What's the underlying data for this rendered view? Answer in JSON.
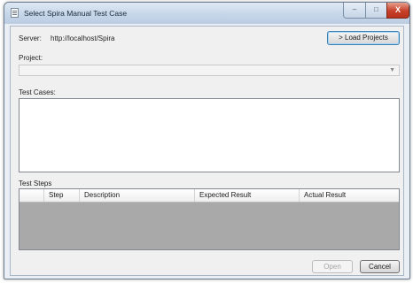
{
  "window": {
    "title": "Select Spira Manual Test Case",
    "controls": {
      "minimize": "–",
      "maximize": "□",
      "close": "X"
    }
  },
  "server": {
    "label": "Server:",
    "value": "http://localhost/Spira"
  },
  "load_projects_label": "> Load Projects",
  "project": {
    "label": "Project:",
    "selected": "",
    "dropdown_icon": "chevron-down-icon"
  },
  "test_cases": {
    "label": "Test Cases:",
    "items": []
  },
  "test_steps": {
    "label": "Test Steps",
    "columns": [
      "",
      "Step",
      "Description",
      "Expected Result",
      "Actual Result"
    ],
    "rows": []
  },
  "buttons": {
    "open": "Open",
    "cancel": "Cancel"
  },
  "colors": {
    "grid_background": "#a9a9a9",
    "titlebar": "#c6d6e9",
    "close_button": "#c6402a"
  }
}
